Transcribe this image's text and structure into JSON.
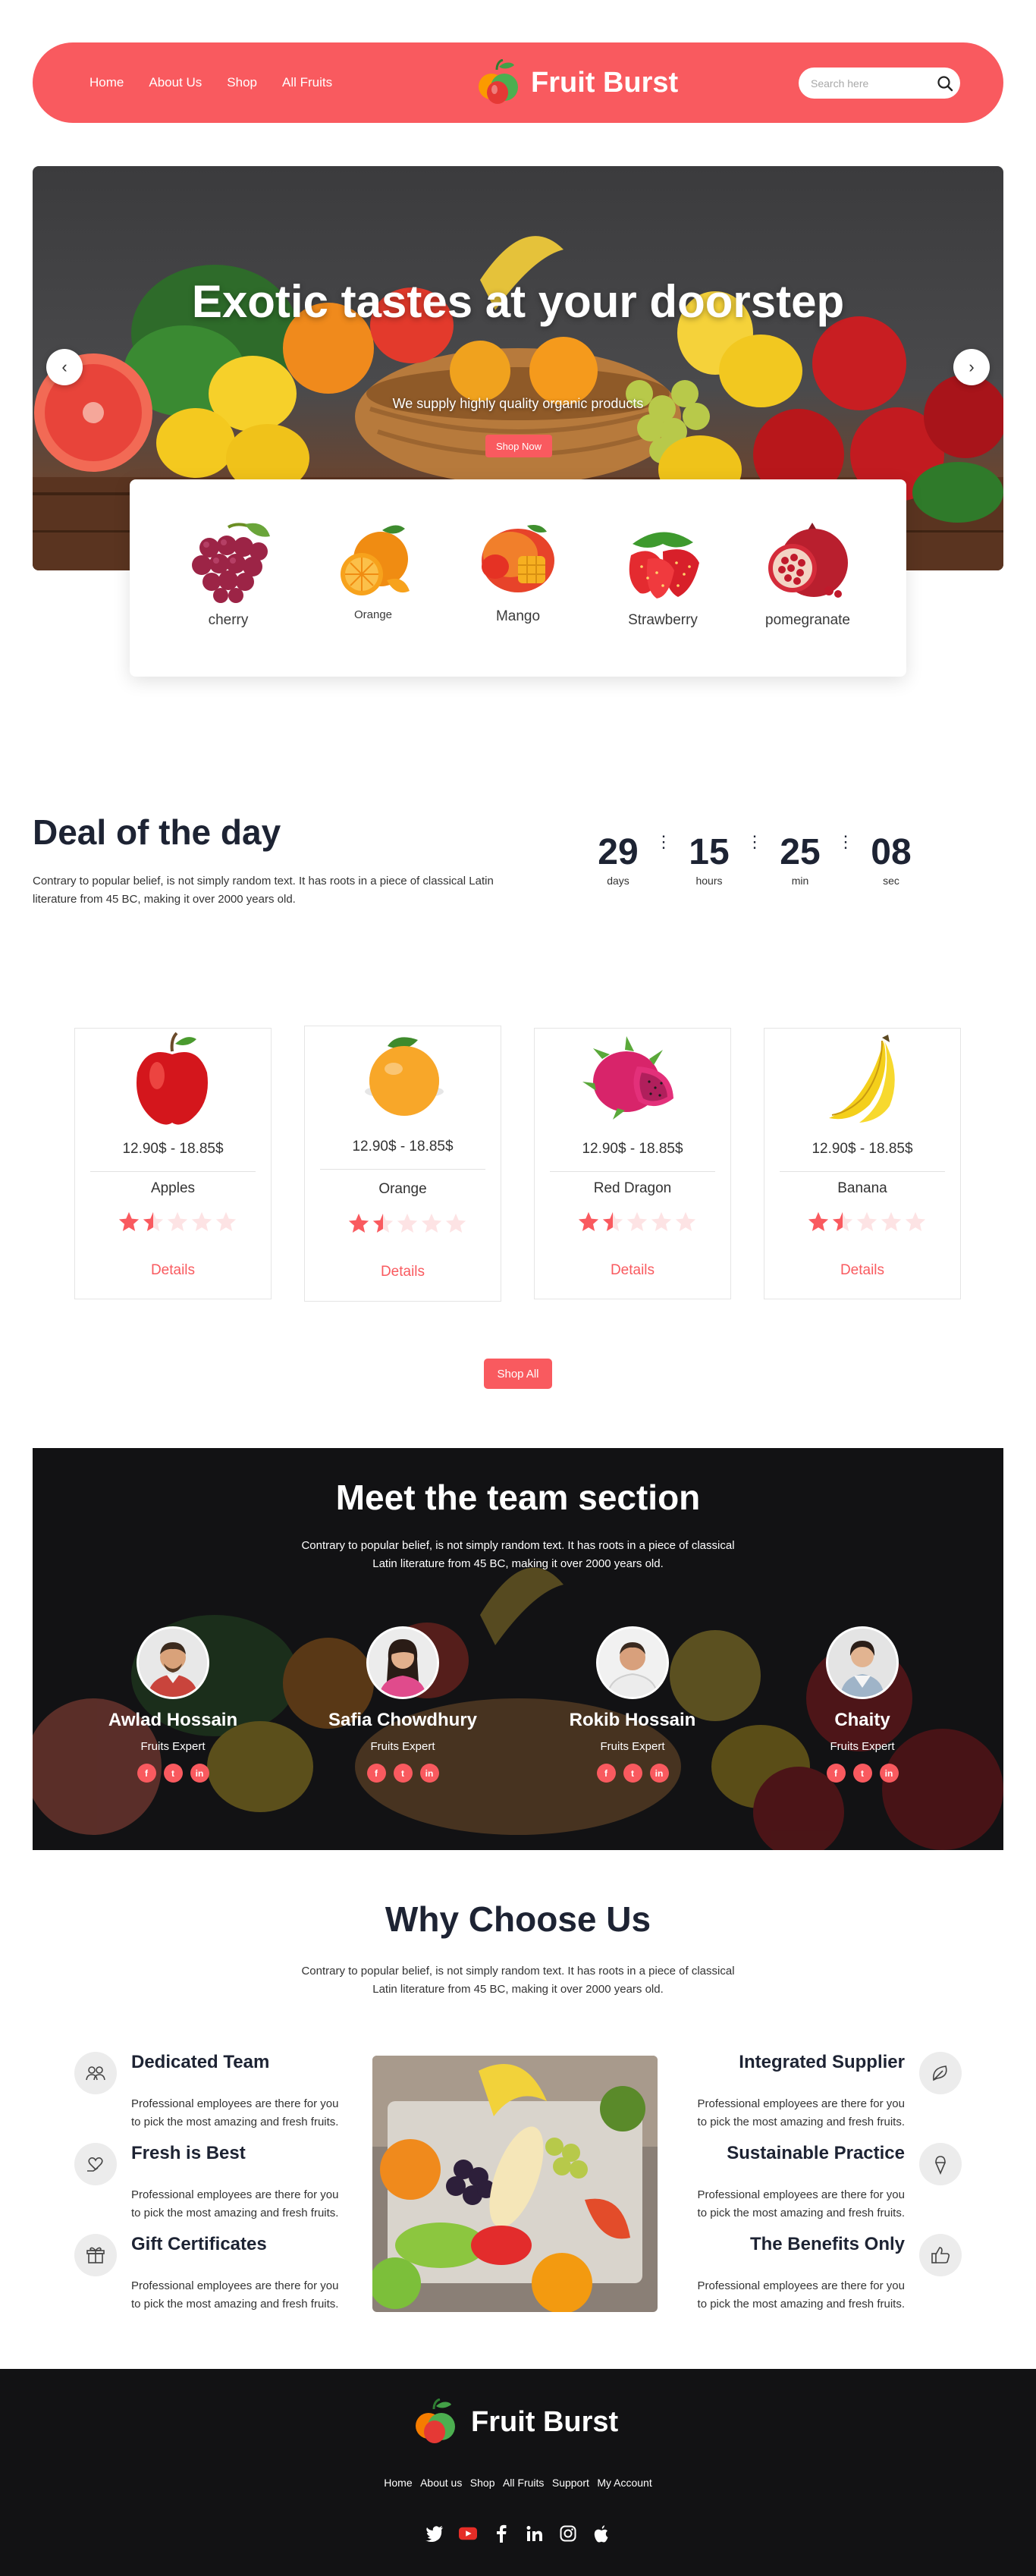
{
  "nav": {
    "links": [
      "Home",
      "About Us",
      "Shop",
      "All Fruits"
    ],
    "brand": "Fruit Burst",
    "search_placeholder": "Search here"
  },
  "hero": {
    "title": "Exotic tastes at your doorstep",
    "subtitle": "We supply highly quality organic products",
    "button": "Shop Now",
    "prev": "‹",
    "next": "›"
  },
  "fruits": [
    "cherry",
    "Orange",
    "Mango",
    "Strawberry",
    "pomegranate"
  ],
  "deal": {
    "title": "Deal of the day",
    "text": "Contrary to popular belief, is not simply random text. It has roots in a piece of classical Latin literature from 45 BC, making it over 2000 years old.",
    "countdown": [
      {
        "value": "29",
        "label": "days"
      },
      {
        "value": "15",
        "label": "hours"
      },
      {
        "value": "25",
        "label": "min"
      },
      {
        "value": "08",
        "label": "sec"
      }
    ],
    "separator": "⋮"
  },
  "products": [
    {
      "price": "12.90$ - 18.85$",
      "name": "Apples",
      "rating": 1.5,
      "details": "Details"
    },
    {
      "price": "12.90$ - 18.85$",
      "name": "Orange",
      "rating": 1.5,
      "details": "Details"
    },
    {
      "price": "12.90$ - 18.85$",
      "name": "Red Dragon",
      "rating": 1.5,
      "details": "Details"
    },
    {
      "price": "12.90$ - 18.85$",
      "name": "Banana",
      "rating": 1.5,
      "details": "Details"
    }
  ],
  "shop_all": "Shop All",
  "team": {
    "title": "Meet the team section",
    "text": "Contrary to popular belief, is not simply random text. It has roots in a piece of classical Latin literature from 45 BC, making it over 2000 years old.",
    "members": [
      {
        "name": "Awlad Hossain",
        "role": "Fruits Expert"
      },
      {
        "name": "Safia Chowdhury",
        "role": "Fruits Expert"
      },
      {
        "name": "Rokib Hossain",
        "role": "Fruits Expert"
      },
      {
        "name": "Chaity",
        "role": "Fruits Expert"
      }
    ],
    "social": [
      "f",
      "t",
      "in"
    ]
  },
  "why": {
    "title": "Why Choose Us",
    "text": "Contrary to popular belief, is not simply random text. It has roots in a piece of classical Latin literature from 45 BC, making it over 2000 years old.",
    "features_left": [
      {
        "title": "Dedicated Team",
        "text": "Professional employees are there for you to pick the most amazing and fresh fruits.",
        "icon": "team-icon"
      },
      {
        "title": "Fresh is Best",
        "text": "Professional employees are there for you to pick the most amazing and fresh fruits.",
        "icon": "heart-hand-icon"
      },
      {
        "title": "Gift Certificates",
        "text": "Professional employees are there for you to pick the most amazing and fresh fruits.",
        "icon": "gift-icon"
      }
    ],
    "features_right": [
      {
        "title": "Integrated Supplier",
        "text": "Professional employees are there for you to pick the most amazing and fresh fruits.",
        "icon": "leaf-icon"
      },
      {
        "title": "Sustainable Practice",
        "text": "Professional employees are there for you to pick the most amazing and fresh fruits.",
        "icon": "ice-cream-icon"
      },
      {
        "title": "The Benefits Only",
        "text": "Professional employees are there for you to pick the most amazing and fresh fruits.",
        "icon": "thumbs-up-icon"
      }
    ]
  },
  "footer": {
    "brand": "Fruit Burst",
    "links": [
      "Home",
      "About us",
      "Shop",
      "All Fruits",
      "Support",
      "My Account"
    ],
    "social_icons": [
      "twitter-icon",
      "youtube-icon",
      "facebook-icon",
      "linkedin-icon",
      "instagram-icon",
      "apple-icon"
    ]
  },
  "colors": {
    "accent": "#f95a5f",
    "dark": "#121214",
    "heading": "#1d2333"
  }
}
